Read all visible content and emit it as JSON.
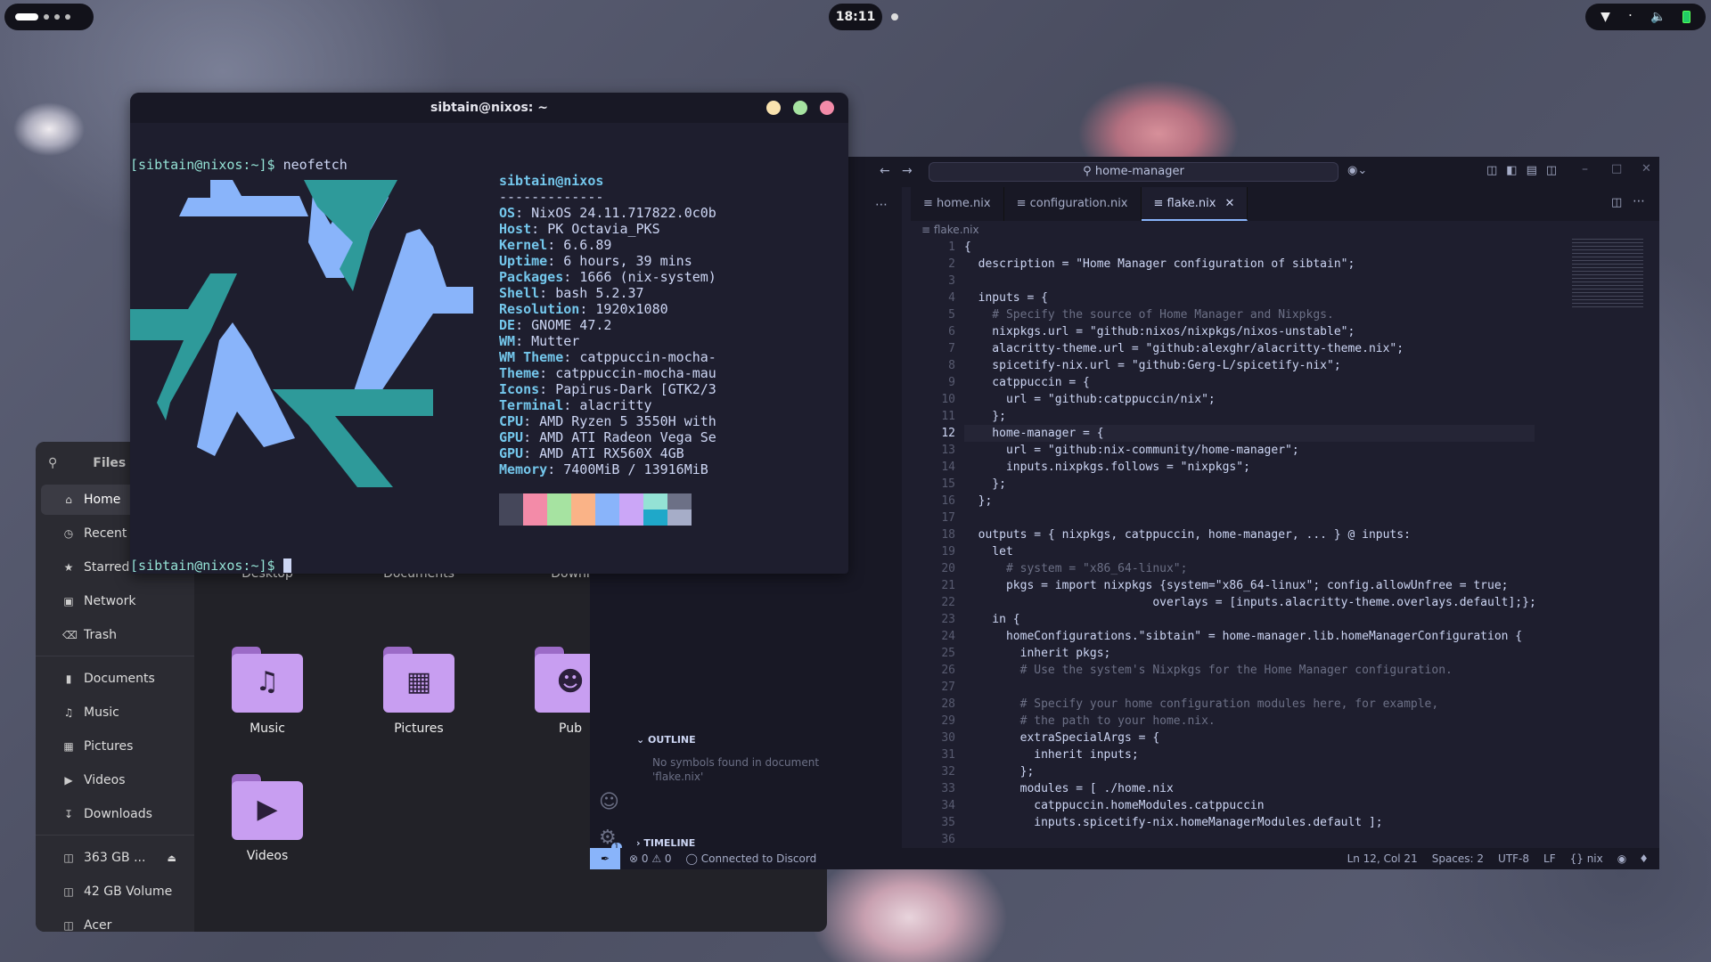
{
  "topbar": {
    "clock": "18:11",
    "tray_icons": [
      "wifi-icon",
      "bluetooth-icon",
      "volume-icon",
      "battery-icon"
    ]
  },
  "files": {
    "title": "Files",
    "sidebar": [
      {
        "label": "Home",
        "icon": "home-icon"
      },
      {
        "label": "Recent",
        "icon": "clock-icon"
      },
      {
        "label": "Starred",
        "icon": "star-icon"
      },
      {
        "label": "Network",
        "icon": "network-icon"
      },
      {
        "label": "Trash",
        "icon": "trash-icon"
      }
    ],
    "bookmarks": [
      {
        "label": "Documents",
        "icon": "document-icon"
      },
      {
        "label": "Music",
        "icon": "music-icon"
      },
      {
        "label": "Pictures",
        "icon": "picture-icon"
      },
      {
        "label": "Videos",
        "icon": "video-icon"
      },
      {
        "label": "Downloads",
        "icon": "download-icon"
      }
    ],
    "drives": [
      {
        "label": "363 GB ...",
        "icon": "drive-icon"
      },
      {
        "label": "42 GB Volume",
        "icon": "drive-icon"
      },
      {
        "label": "Acer",
        "icon": "drive-icon"
      }
    ],
    "folders": [
      "Desktop",
      "Documents",
      "Downl",
      "Music",
      "Pictures",
      "Pub",
      "Videos"
    ]
  },
  "terminal": {
    "title": "sibtain@nixos: ~",
    "prompt1": "[sibtain@nixos:~]$",
    "command": "neofetch",
    "prompt2": "[sibtain@nixos:~]$",
    "user_host": "sibtain@nixos",
    "separator": "-------------",
    "info": [
      {
        "key": "OS",
        "value": "NixOS 24.11.717822.0c0b"
      },
      {
        "key": "Host",
        "value": "PK Octavia_PKS"
      },
      {
        "key": "Kernel",
        "value": "6.6.89"
      },
      {
        "key": "Uptime",
        "value": "6 hours, 39 mins"
      },
      {
        "key": "Packages",
        "value": "1666 (nix-system)"
      },
      {
        "key": "Shell",
        "value": "bash 5.2.37"
      },
      {
        "key": "Resolution",
        "value": "1920x1080"
      },
      {
        "key": "DE",
        "value": "GNOME 47.2"
      },
      {
        "key": "WM",
        "value": "Mutter"
      },
      {
        "key": "WM Theme",
        "value": "catppuccin-mocha-"
      },
      {
        "key": "Theme",
        "value": "catppuccin-mocha-mau"
      },
      {
        "key": "Icons",
        "value": "Papirus-Dark [GTK2/3"
      },
      {
        "key": "Terminal",
        "value": "alacritty"
      },
      {
        "key": "CPU",
        "value": "AMD Ryzen 5 3550H with"
      },
      {
        "key": "GPU",
        "value": "AMD ATI Radeon Vega Se"
      },
      {
        "key": "GPU",
        "value": "AMD ATI RX560X 4GB"
      },
      {
        "key": "Memory",
        "value": "7400MiB / 13916MiB"
      }
    ],
    "palette_top": [
      "#45475a",
      "#f38ba8",
      "#a6e3a1",
      "#fab387",
      "#89b4fa",
      "#cba6f7",
      "#94e2d5",
      "#6c7086"
    ],
    "palette_bottom": [
      "#45475a",
      "#f38ba8",
      "#a6e3a1",
      "#fab387",
      "#89b4fa",
      "#cba6f7",
      "#1fa8c9",
      "#a6adc8"
    ]
  },
  "editor": {
    "command_center": "home-manager",
    "tabs": [
      "home.nix",
      "configuration.nix",
      "flake.nix"
    ],
    "breadcrumb": "flake.nix",
    "outline_title": "OUTLINE",
    "outline_empty": "No symbols found in document 'flake.nix'",
    "timeline_title": "TIMELINE",
    "notification_count": "1",
    "code": [
      "{",
      "  description = \"Home Manager configuration of sibtain\";",
      "",
      "  inputs = {",
      "    # Specify the source of Home Manager and Nixpkgs.",
      "    nixpkgs.url = \"github:nixos/nixpkgs/nixos-unstable\";",
      "    alacritty-theme.url = \"github:alexghr/alacritty-theme.nix\";",
      "    spicetify-nix.url = \"github:Gerg-L/spicetify-nix\";",
      "    catppuccin = {",
      "      url = \"github:catppuccin/nix\";",
      "    };",
      "    home-manager = {",
      "      url = \"github:nix-community/home-manager\";",
      "      inputs.nixpkgs.follows = \"nixpkgs\";",
      "    };",
      "  };",
      "",
      "  outputs = { nixpkgs, catppuccin, home-manager, ... } @ inputs:",
      "    let",
      "      # system = \"x86_64-linux\";",
      "      pkgs = import nixpkgs {system=\"x86_64-linux\"; config.allowUnfree = true;",
      "                           overlays = [inputs.alacritty-theme.overlays.default];};",
      "    in {",
      "      homeConfigurations.\"sibtain\" = home-manager.lib.homeManagerConfiguration {",
      "        inherit pkgs;",
      "        # Use the system's Nixpkgs for the Home Manager configuration.",
      "",
      "        # Specify your home configuration modules here, for example,",
      "        # the path to your home.nix.",
      "        extraSpecialArgs = {",
      "          inherit inputs;",
      "        };",
      "        modules = [ ./home.nix",
      "          catppuccin.homeModules.catppuccin",
      "          inputs.spicetify-nix.homeManagerModules.default ];",
      ""
    ],
    "current_line": 12,
    "status": {
      "problems": "0",
      "warnings": "0",
      "discord": "Connected to Discord",
      "position": "Ln 12, Col 21",
      "spaces": "Spaces: 2",
      "encoding": "UTF-8",
      "eol": "LF",
      "language": "nix"
    }
  }
}
